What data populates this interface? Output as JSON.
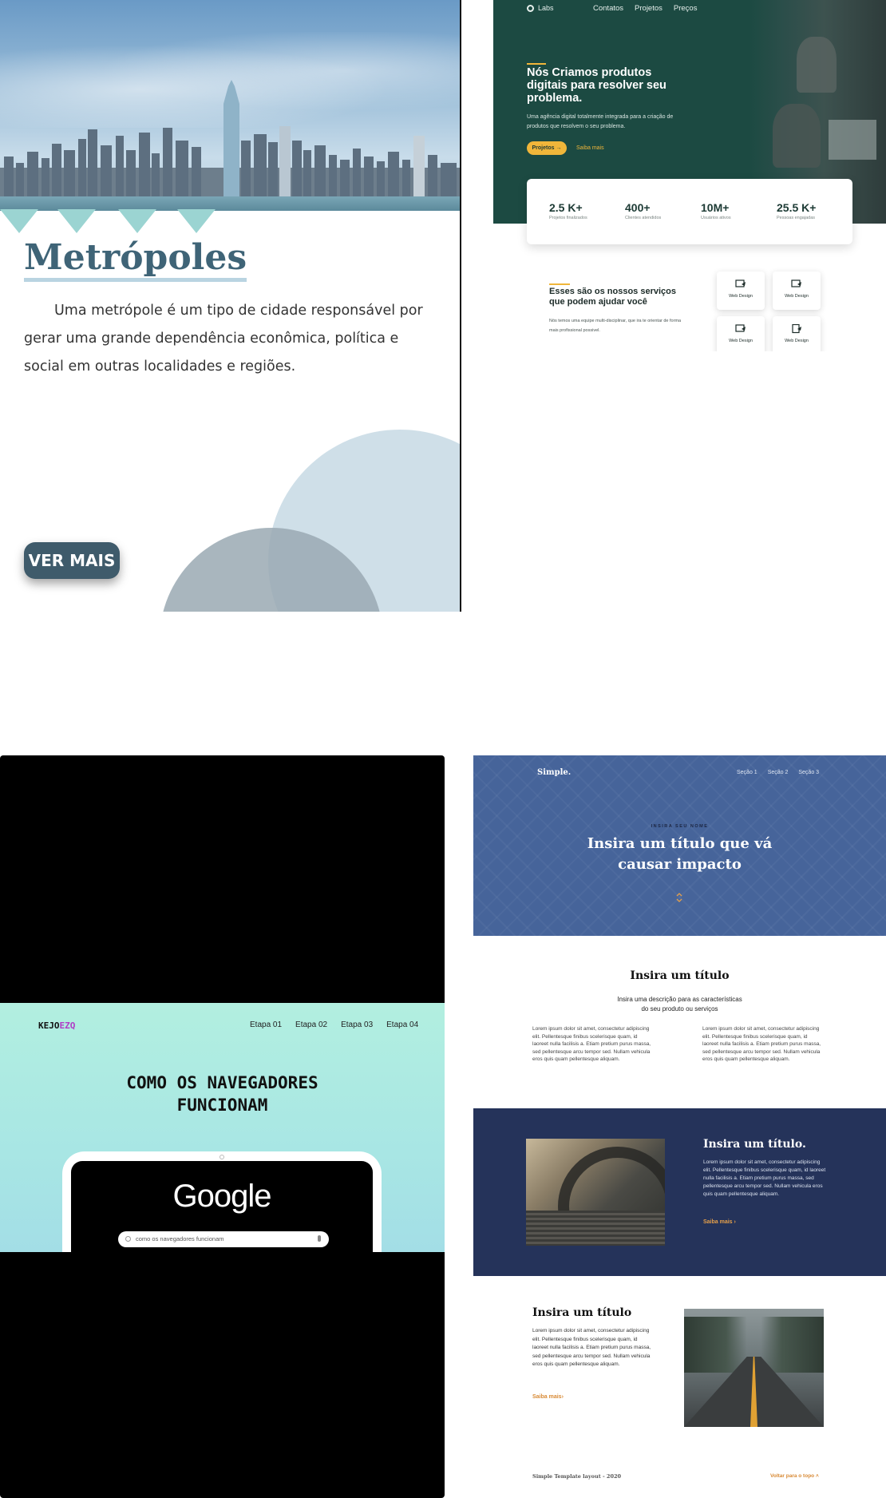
{
  "metropoles": {
    "title": "Metrópoles",
    "description": "Uma metrópole é um tipo de cidade responsável por gerar uma grande dependência econômica, política e social em outras localidades e regiões.",
    "button_label": "VER MAIS",
    "colors": {
      "title": "#3f6477",
      "button": "#3f5b6b",
      "accent_shapes": "#9bd4d2"
    }
  },
  "labs": {
    "logo_text": "Labs",
    "nav": [
      "Contatos",
      "Projetos",
      "Preços"
    ],
    "headline": "Nós Criamos produtos digitais para resolver seu problema.",
    "subtext": "Uma agência digital  totalmente integrada para a criação de produtos que resolvem o seu problema.",
    "primary_button": "Projetos →",
    "secondary_link": "Saiba mais",
    "stats": [
      {
        "value": "2.5 K+",
        "label": "Projetos finalizados"
      },
      {
        "value": "400+",
        "label": "Clientes atendidos"
      },
      {
        "value": "10M+",
        "label": "Usuários ativos"
      },
      {
        "value": "25.5 K+",
        "label": "Pessoas engajadas"
      }
    ],
    "services_title": "Esses são os nossos serviços que podem ajudar você",
    "services_desc": "Nós temos uma equipe multi-disciplinar, que ira te orientar de forma mais profissional possivel.",
    "service_cards": [
      "Web Design",
      "Web Design",
      "Web Design",
      "Web Design"
    ],
    "colors": {
      "hero": "#1c4a42",
      "accent": "#f0b63a"
    }
  },
  "kejoezq": {
    "brand_a": "KEJO",
    "brand_b": "EZQ",
    "nav": [
      "Etapa 01",
      "Etapa 02",
      "Etapa 03",
      "Etapa 04"
    ],
    "headline_1": "COMO OS NAVEGADORES",
    "headline_2": "FUNCIONAM",
    "logo_word": "Google",
    "search_value": "como os navegadores funcionam",
    "colors": {
      "band": "#a8e6e4",
      "brand_highlight": "#b03dc6"
    }
  },
  "simple": {
    "brand": "Simple.",
    "nav": [
      "Seção 1",
      "Seção 2",
      "Seção 3"
    ],
    "kicker": "INSIRA SEU NOME",
    "hero_title_1": "Insira um título que vá",
    "hero_title_2": "causar impacto",
    "section1_title": "Insira um título",
    "section1_desc_1": "Insira uma descrição para as características",
    "section1_desc_2": "do seu produto ou serviços",
    "section1_col_left": "Lorem ipsum dolor sit amet, consectetur adipiscing elit. Pellentesque finibus scelerisque quam, id laoreet nulla facilisis a. Etiam pretium purus massa, sed pellentesque arcu tempor sed. Nullam vehicula eros quis quam pellentesque aliquam.",
    "section1_col_right": "Lorem ipsum dolor sit amet, consectetur adipiscing elit. Pellentesque finibus scelerisque quam, id laoreet nulla facilisis a. Etiam pretium purus massa, sed pellentesque arcu tempor sed. Nullam vehicula eros quis quam pellentesque aliquam.",
    "section2_title": "Insira um título.",
    "section2_desc": "Lorem ipsum dolor sit amet, consectetur adipiscing elit. Pellentesque finibus scelerisque quam, id laoreet nulla facilisis a. Etiam pretium purus massa, sed pellentesque arcu tempor sed. Nullam vehicula eros quis quam pellentesque aliquam.",
    "section2_link": "Saiba mais",
    "section3_title": "Insira um título",
    "section3_desc": "Lorem ipsum dolor sit amet, consectetur adipiscing elit. Pellentesque finibus scelerisque quam, id laoreet nulla facilisis a. Etiam pretium purus massa, sed pellentesque arcu tempor sed. Nullam vehicula eros quis quam pellentesque aliquam.",
    "section3_link": "Saiba mais",
    "footer_left": "Simple Template layout - 2020",
    "footer_right": "Voltar para o topo",
    "colors": {
      "hero": "#46649a",
      "dark_section": "#25335a",
      "accent": "#d88a35"
    }
  }
}
